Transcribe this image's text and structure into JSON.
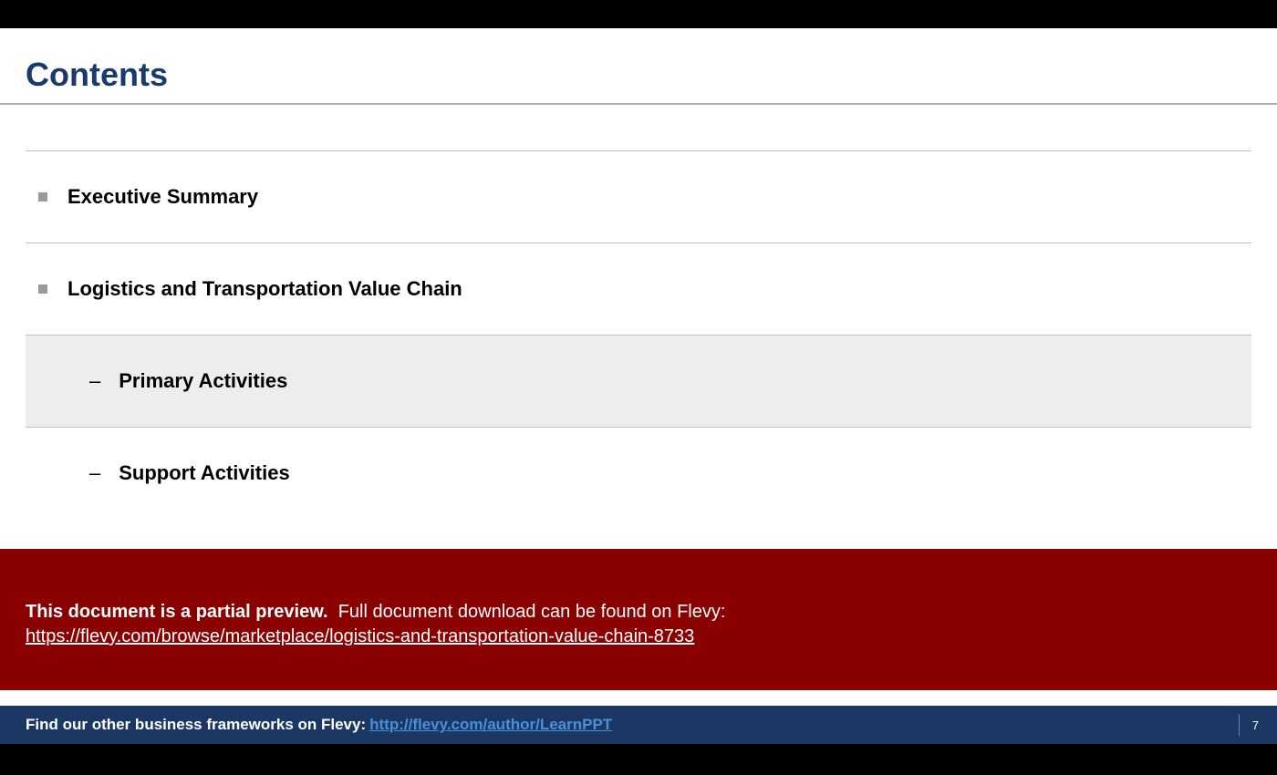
{
  "slide": {
    "title": "Contents",
    "items": [
      {
        "label": "Executive Summary",
        "level": 1,
        "highlighted": false
      },
      {
        "label": "Logistics and Transportation Value Chain",
        "level": 1,
        "highlighted": false
      },
      {
        "label": "Primary Activities",
        "level": 2,
        "highlighted": true
      },
      {
        "label": "Support Activities",
        "level": 2,
        "highlighted": false
      }
    ]
  },
  "preview_banner": {
    "bold_text": "This document is a partial preview.",
    "rest_text": "Full document download can be found on Flevy:",
    "link_text": "https://flevy.com/browse/marketplace/logistics-and-transportation-value-chain-8733"
  },
  "footer": {
    "prefix": "Find our other business frameworks on Flevy:",
    "link": "http://flevy.com/author/LearnPPT",
    "page_number": "7"
  }
}
